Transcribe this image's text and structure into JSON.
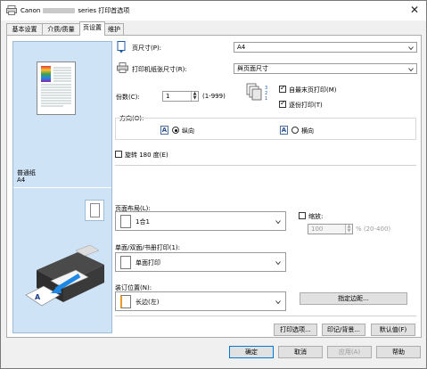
{
  "window": {
    "title_prefix": "Canon",
    "title_suffix": "series 打印首选项",
    "close_symbol": "✕"
  },
  "tabs": [
    {
      "label": "基本设置"
    },
    {
      "label": "介质/质量"
    },
    {
      "label": "页设置"
    },
    {
      "label": "维护"
    }
  ],
  "preview": {
    "media_label": "普通纸",
    "size_label": "A4"
  },
  "page_size": {
    "label": "页尺寸(P):",
    "value": "A4"
  },
  "printer_paper_size": {
    "label": "打印机纸张尺寸(R):",
    "value": "與页面尺寸"
  },
  "copies": {
    "label": "份数(C):",
    "value": "1",
    "range": "(1-999)"
  },
  "collate": {
    "last_page_first_label": "自最末页打印(M)",
    "collate_label": "逐份打印(T)"
  },
  "orientation": {
    "group_label": "方向(O):",
    "portrait_label": "纵向",
    "landscape_label": "横向",
    "icon_letter": "A"
  },
  "rotate": {
    "label": "旋转 180 度(E)"
  },
  "page_layout": {
    "label": "页面布局(L):",
    "value": "1合1"
  },
  "scaling": {
    "label": "缩放:",
    "value": "100",
    "range": "% (20-400)"
  },
  "duplex": {
    "label": "单面/双面/书册打印(1):",
    "value": "单面打印"
  },
  "stapling": {
    "label": "装订位置(N):",
    "value": "长边(左)"
  },
  "buttons": {
    "margin": "指定边距...",
    "print_options": "打印选项...",
    "stamp_background": "印记/背景...",
    "defaults": "默认值(F)",
    "ok": "确定",
    "cancel": "取消",
    "apply": "应用(A)",
    "help": "帮助"
  }
}
